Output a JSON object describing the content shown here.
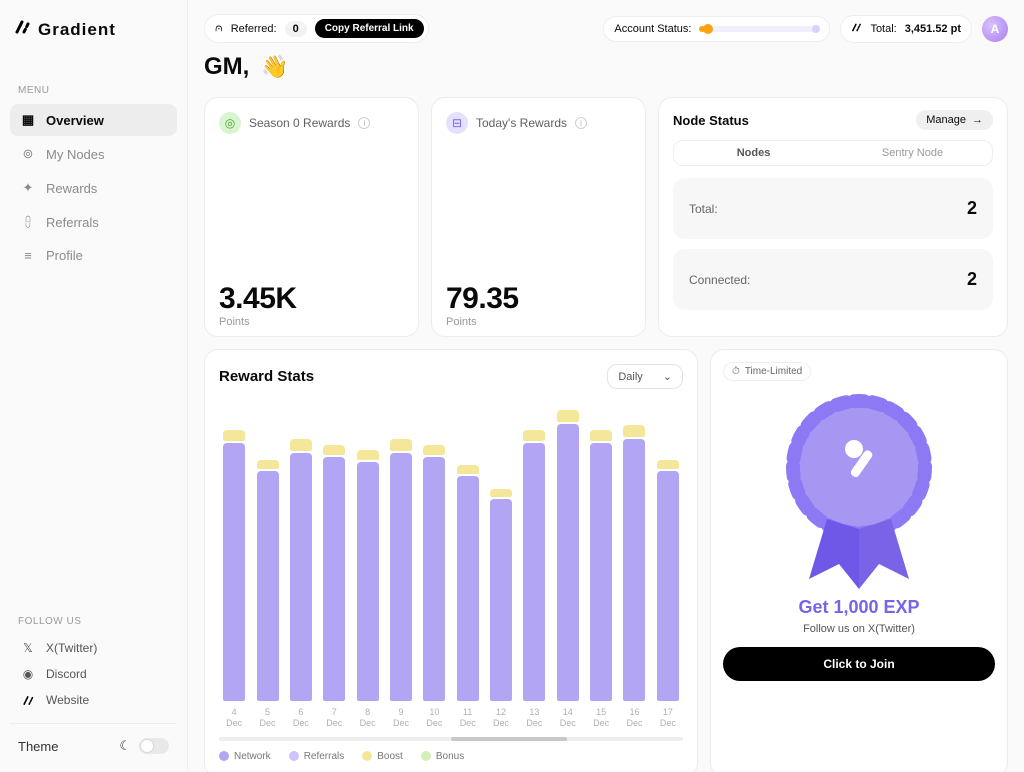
{
  "brand": "Gradient",
  "sidebar": {
    "menu_label": "MENU",
    "items": [
      {
        "label": "Overview",
        "icon": "grid"
      },
      {
        "label": "My Nodes",
        "icon": "nodes"
      },
      {
        "label": "Rewards",
        "icon": "gift"
      },
      {
        "label": "Referrals",
        "icon": "users"
      },
      {
        "label": "Profile",
        "icon": "settings"
      }
    ],
    "follow_label": "FOLLOW US",
    "follow": [
      {
        "label": "X(Twitter)",
        "icon": "x"
      },
      {
        "label": "Discord",
        "icon": "discord"
      },
      {
        "label": "Website",
        "icon": "web"
      }
    ],
    "theme_label": "Theme"
  },
  "topbar": {
    "referred_label": "Referred:",
    "referred_count": "0",
    "copy_btn": "Copy Referral Link",
    "account_status_label": "Account Status:",
    "total_label": "Total:",
    "total_value": "3,451.52 pt",
    "avatar_initial": "A"
  },
  "greeting": "GM,",
  "colors": {
    "accent": "#7a63e6"
  },
  "rewards": {
    "season": {
      "title": "Season 0 Rewards",
      "value": "3.45K",
      "unit": "Points"
    },
    "today": {
      "title": "Today's Rewards",
      "value": "79.35",
      "unit": "Points"
    }
  },
  "node_status": {
    "title": "Node Status",
    "manage": "Manage",
    "tabs": [
      "Nodes",
      "Sentry Node"
    ],
    "rows": [
      {
        "k": "Total:",
        "v": "2"
      },
      {
        "k": "Connected:",
        "v": "2"
      }
    ]
  },
  "chart": {
    "title": "Reward Stats",
    "range": "Daily",
    "legend": {
      "network": "Network",
      "referrals": "Referrals",
      "boost": "Boost",
      "bonus": "Bonus"
    }
  },
  "chart_data": {
    "type": "bar",
    "title": "Reward Stats",
    "xlabel": "",
    "ylabel": "",
    "ylim": [
      0,
      320
    ],
    "categories": [
      "4 Dec",
      "5 Dec",
      "6 Dec",
      "7 Dec",
      "8 Dec",
      "9 Dec",
      "10 Dec",
      "11 Dec",
      "12 Dec",
      "13 Dec",
      "14 Dec",
      "15 Dec",
      "16 Dec",
      "17 Dec"
    ],
    "series": [
      {
        "name": "Network",
        "values": [
          275,
          245,
          265,
          260,
          255,
          265,
          260,
          240,
          215,
          275,
          295,
          275,
          280,
          245
        ]
      },
      {
        "name": "Boost",
        "values": [
          12,
          10,
          12,
          11,
          11,
          12,
          11,
          10,
          9,
          12,
          13,
          12,
          12,
          10
        ]
      }
    ]
  },
  "promo": {
    "tag": "Time-Limited",
    "title": "Get 1,000 EXP",
    "sub": "Follow us on X(Twitter)",
    "cta": "Click to Join"
  }
}
